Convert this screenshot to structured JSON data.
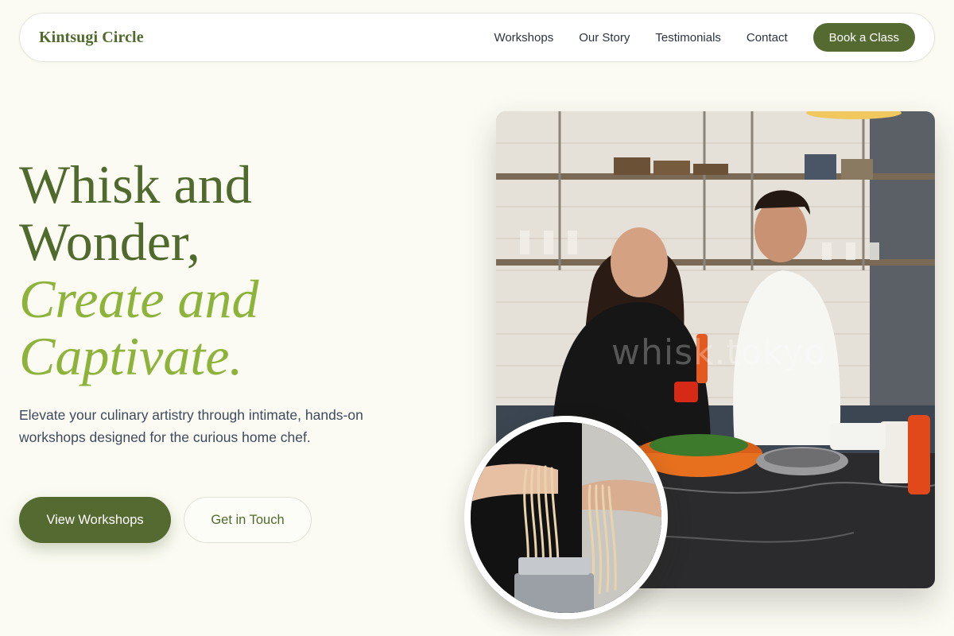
{
  "brand": {
    "name": "Kintsugi Circle"
  },
  "nav": {
    "links": [
      "Workshops",
      "Our Story",
      "Testimonials",
      "Contact"
    ],
    "cta_label": "Book a Class"
  },
  "hero": {
    "title_line1": "Whisk and",
    "title_line2": "Wonder,",
    "title_accent_line1": "Create and",
    "title_accent_line2": "Captivate.",
    "description": "Elevate your culinary artistry through intimate, hands-on workshops designed for the curious home chef.",
    "primary_cta": "View Workshops",
    "secondary_cta": "Get in Touch"
  },
  "image": {
    "watermark": "whisk.tokyo"
  },
  "colors": {
    "background": "#fbfbf3",
    "brand_dark": "#4f6a2c",
    "brand_light": "#8db33a",
    "button": "#546a31"
  },
  "icons": [
    "hero-photo",
    "pasta-photo"
  ]
}
